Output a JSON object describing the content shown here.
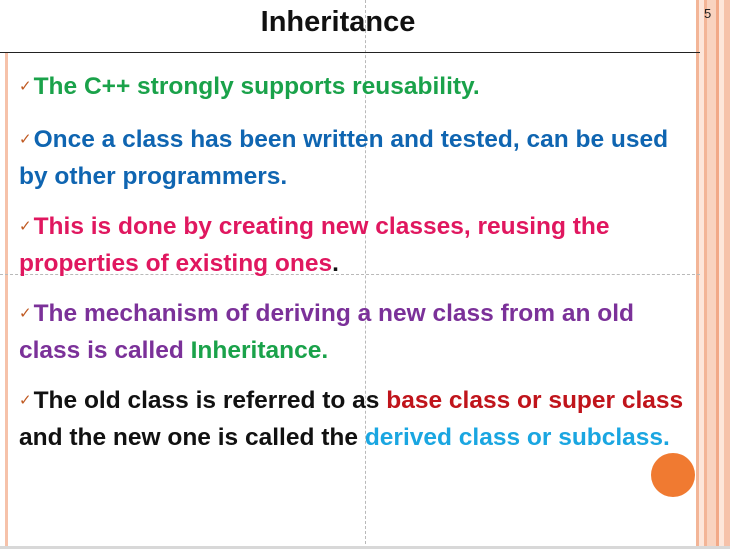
{
  "slide": {
    "title": "Inheritance",
    "page_number": "5",
    "check_glyph": "✓",
    "colors": {
      "green": "#1aa24a",
      "blue": "#0f65b1",
      "pink": "#e0175f",
      "purple": "#7b3199",
      "black": "#111111",
      "red": "#c0141b",
      "cyan": "#1aa6e1",
      "accent_circle": "#f07a31",
      "stripe": "#f6c2aa"
    },
    "bullets": [
      {
        "runs": [
          {
            "text": "The C++ strongly supports reusability.",
            "color": "#1aa24a"
          }
        ]
      },
      {
        "runs": [
          {
            "text": "Once a class has been written and tested, can be used by other programmers.",
            "color": "#0f65b1"
          }
        ]
      },
      {
        "runs": [
          {
            "text": "This is done by creating new classes, reusing the properties of existing ones",
            "color": "#e0175f"
          },
          {
            "text": ".",
            "color": "#111111"
          }
        ]
      },
      {
        "runs": [
          {
            "text": "The mechanism of deriving a new class from an old class is called ",
            "color": "#7b3199"
          },
          {
            "text": "Inheritance.",
            "color": "#1aa24a"
          }
        ]
      },
      {
        "runs": [
          {
            "text": "The old class is referred to as ",
            "color": "#111111"
          },
          {
            "text": "base class or super class",
            "color": "#c0141b"
          },
          {
            "text": " and the new one is called the ",
            "color": "#111111"
          },
          {
            "text": "derived class or subclass.",
            "color": "#1aa6e1"
          }
        ]
      }
    ]
  }
}
